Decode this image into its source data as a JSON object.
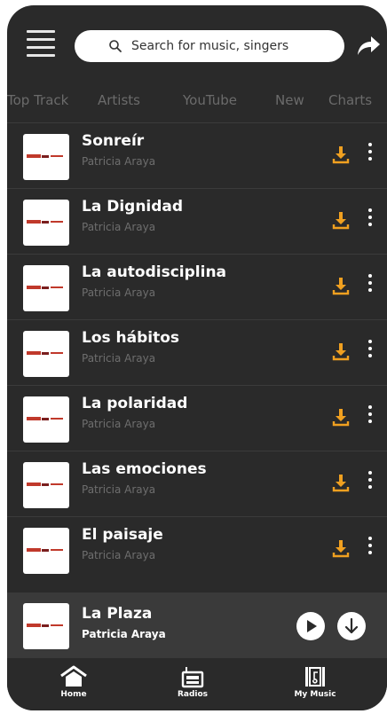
{
  "header": {
    "search_placeholder": "Search for music, singers",
    "menu_icon": "hamburger-menu-icon",
    "share_icon": "share-arrow-icon"
  },
  "tabs": [
    {
      "label": "Top Track"
    },
    {
      "label": "Artists"
    },
    {
      "label": "YouTube"
    },
    {
      "label": "New"
    },
    {
      "label": "Charts"
    }
  ],
  "tracks": [
    {
      "title": "Sonreír",
      "artist": "Patricia Araya"
    },
    {
      "title": "La Dignidad",
      "artist": "Patricia Araya"
    },
    {
      "title": "La autodisciplina",
      "artist": "Patricia Araya"
    },
    {
      "title": "Los hábitos",
      "artist": "Patricia Araya"
    },
    {
      "title": "La polaridad",
      "artist": "Patricia Araya"
    },
    {
      "title": "Las emociones",
      "artist": "Patricia Araya"
    },
    {
      "title": "El paisaje",
      "artist": "Patricia Araya"
    }
  ],
  "now_playing": {
    "title": "La Plaza",
    "artist": "Patricia Araya"
  },
  "nav": [
    {
      "label": "Home",
      "icon": "home-icon"
    },
    {
      "label": "Radios",
      "icon": "radio-icon"
    },
    {
      "label": "My Music",
      "icon": "music-library-icon"
    }
  ],
  "colors": {
    "background": "#2a2a2a",
    "accent_download": "#f0a020",
    "player_bar": "#3a3a3a"
  }
}
